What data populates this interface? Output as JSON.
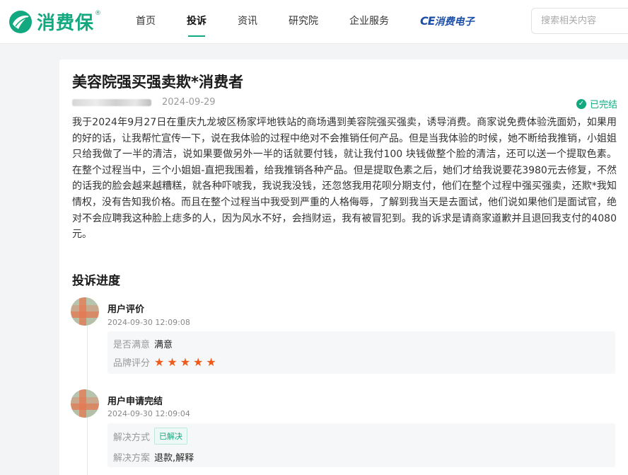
{
  "brand": {
    "name": "消费保",
    "reg_mark": "®",
    "color": "#13a980"
  },
  "nav": {
    "items": [
      {
        "label": "首页",
        "active": false
      },
      {
        "label": "投诉",
        "active": true
      },
      {
        "label": "资讯",
        "active": false
      },
      {
        "label": "研究院",
        "active": false
      },
      {
        "label": "企业服务",
        "active": false
      }
    ],
    "ce_logo": {
      "prefix": "CE",
      "text": "消费电子"
    }
  },
  "search": {
    "placeholder": "搜索相关内容"
  },
  "complaint": {
    "title": "美容院强买强卖欺*消费者",
    "date": "2024-09-29",
    "status": "已完结",
    "description": "我于2024年9月27日在重庆九龙坡区杨家坪地铁站的商场遇到美容院强买强卖，诱导消费。商家说免费体验洗面奶，如果用的好的话，让我帮忙宣传一下，说在我体验的过程中绝对不会推销任何产品。但是当我体验的时候，她不断给我推销，小姐姐只给我做了一半的清洁，说如果要做另外一半的话就要付钱，就让我付100 块钱做整个脸的清洁，还可以送一个提取色素。在整个过程当中，三个小姐姐-直把我围着，给我推销各种产品。但是提取色素之后，她们才给我说要花3980元去修复，不然的话我的脸会越来越糟糕，就各种吓唬我，我说我没钱，还忽悠我用花呗分期支付，他们在整个过程中强买强卖，还欺*我知情权，没有告知我价格。而且在整个过程当中我受到严重的人格侮辱，了解到我当天是去面试，他们说如果他们是面试官，绝对不会应聘我这种脸上痣多的人，因为风水不好，会挡财运，我有被冒犯到。我的诉求是请商家道歉并且退回我支付的4080元。"
  },
  "progress": {
    "title": "投诉进度",
    "steps": [
      {
        "name": "用户评价",
        "time": "2024-09-30 12:09:08",
        "satisfied_label": "是否满意",
        "satisfied_value": "满意",
        "rating_label": "品牌评分",
        "rating": 5,
        "rating_max": 5
      },
      {
        "name": "用户申请完结",
        "time": "2024-09-30 12:09:04",
        "method_label": "解决方式",
        "method_value": "已解决",
        "plan_label": "解决方案",
        "plan_value": "退款,解释"
      }
    ]
  }
}
